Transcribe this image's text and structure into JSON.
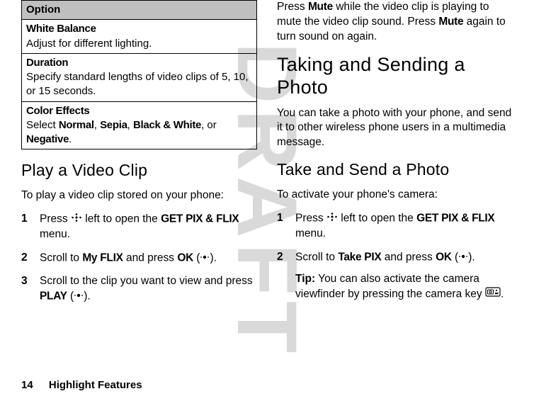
{
  "watermark": "DRAFT",
  "left": {
    "table_header": "Option",
    "rows": [
      {
        "head": "White Balance",
        "body": "Adjust for different lighting."
      },
      {
        "head": "Duration",
        "body": "Specify standard lengths of video clips of 5, 10, or 15 seconds."
      },
      {
        "head": "Color Effects",
        "body_prefix": "Select ",
        "opts": [
          "Normal",
          "Sepia",
          "Black & White",
          "Negative"
        ],
        "body_suffix": "."
      }
    ],
    "h2": "Play a Video Clip",
    "intro": "To play a video clip stored on your phone:",
    "steps": [
      {
        "pre": "Press ",
        "mid": " left to open the ",
        "bold": "GET PIX & FLIX",
        "post": " menu."
      },
      {
        "pre": "Scroll to ",
        "bold1": "My FLIX",
        "mid": " and press ",
        "bold2": "OK",
        "paren": " (",
        "post": ")."
      },
      {
        "pre": "Scroll to the clip you want to view and press ",
        "bold": "PLAY",
        "paren": " (",
        "post": ")."
      }
    ]
  },
  "right": {
    "top_para_1a": "Press ",
    "top_bold1": "Mute",
    "top_para_1b": " while the video clip is playing to mute the video clip sound. Press ",
    "top_bold2": "Mute",
    "top_para_1c": " again to turn sound on again.",
    "h1": "Taking and Sending a Photo",
    "p2": "You can take a photo with your phone, and send it to other wireless phone users in a multimedia message.",
    "h2": "Take and Send a Photo",
    "intro": "To activate your phone's camera:",
    "steps": [
      {
        "pre": "Press ",
        "mid": " left to open the ",
        "bold": "GET PIX & FLIX",
        "post": " menu."
      },
      {
        "pre": "Scroll to ",
        "bold1": "Take PIX",
        "mid": " and press ",
        "bold2": "OK",
        "paren": " (",
        "post": ")."
      }
    ],
    "tip_label": "Tip:",
    "tip_body": " You can also activate the camera viewfinder by pressing the camera key "
  },
  "footer": {
    "page": "14",
    "section": "Highlight Features"
  }
}
